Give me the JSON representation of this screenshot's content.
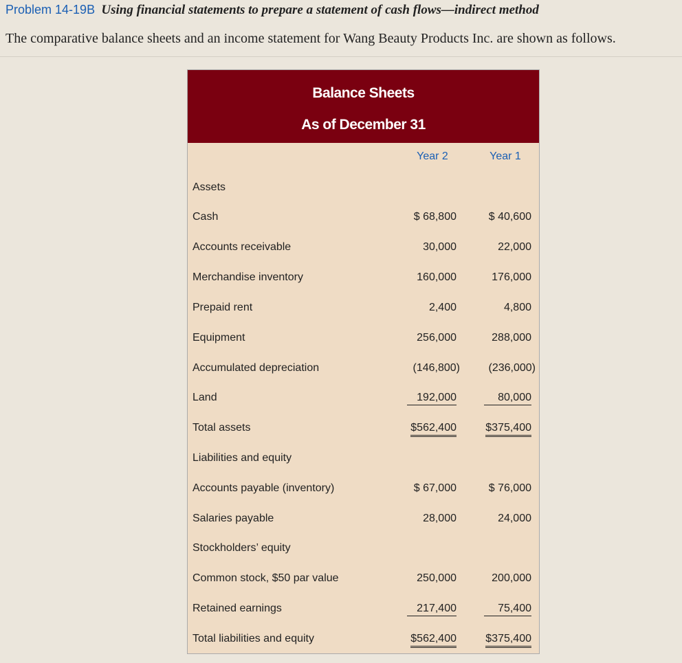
{
  "problem": {
    "number": "Problem 14-19B",
    "title": "Using financial statements to prepare a statement of cash flows—indirect method",
    "intro": "The comparative balance sheets and an income statement for Wang Beauty Products Inc. are shown as follows."
  },
  "balance_sheet": {
    "title": "Balance Sheets",
    "subtitle": "As of December 31",
    "columns": [
      "Year 2",
      "Year 1"
    ],
    "rows": [
      {
        "label": "Assets",
        "year2": "",
        "year1": ""
      },
      {
        "label": "Cash",
        "year2": "$ 68,800",
        "year1": "$ 40,600"
      },
      {
        "label": "Accounts receivable",
        "year2": "30,000",
        "year1": "22,000"
      },
      {
        "label": "Merchandise inventory",
        "year2": "160,000",
        "year1": "176,000"
      },
      {
        "label": "Prepaid rent",
        "year2": "2,400",
        "year1": "4,800"
      },
      {
        "label": "Equipment",
        "year2": "256,000",
        "year1": "288,000"
      },
      {
        "label": "Accumulated depreciation",
        "year2": "(146,800)",
        "year1": "(236,000)"
      },
      {
        "label": "Land",
        "year2": "192,000",
        "year1": "80,000"
      },
      {
        "label": "Total assets",
        "year2": "$562,400",
        "year1": "$375,400"
      },
      {
        "label": "Liabilities and equity",
        "year2": "",
        "year1": ""
      },
      {
        "label": "Accounts payable (inventory)",
        "year2": "$ 67,000",
        "year1": "$ 76,000"
      },
      {
        "label": "Salaries payable",
        "year2": "28,000",
        "year1": "24,000"
      },
      {
        "label": "Stockholders’ equity",
        "year2": "",
        "year1": ""
      },
      {
        "label": "Common stock, $50 par value",
        "year2": "250,000",
        "year1": "200,000"
      },
      {
        "label": "Retained earnings",
        "year2": "217,400",
        "year1": "75,400"
      },
      {
        "label": "Total liabilities and equity",
        "year2": "$562,400",
        "year1": "$375,400"
      }
    ]
  }
}
